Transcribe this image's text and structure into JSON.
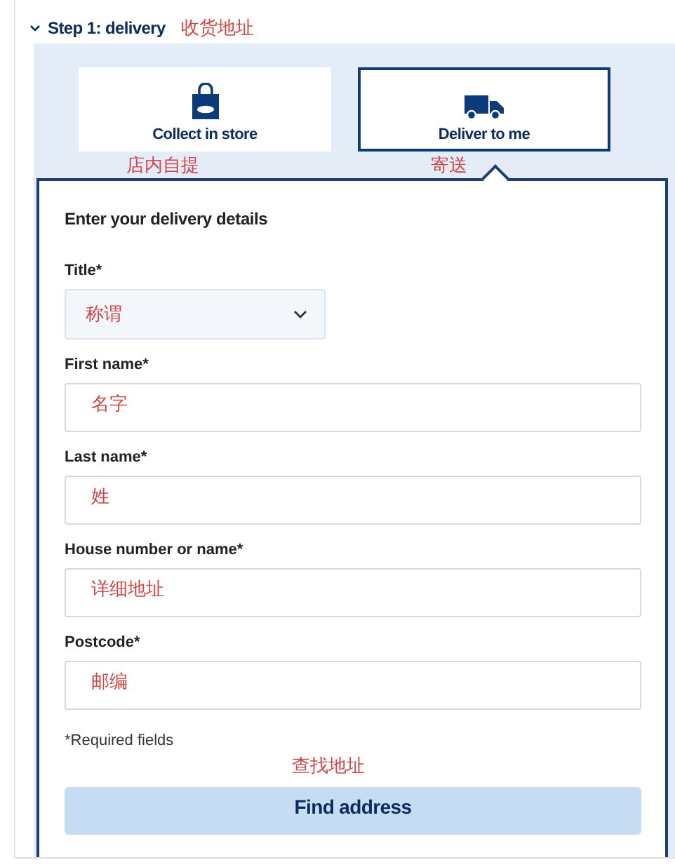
{
  "step": {
    "title": "Step 1: delivery",
    "expanded": true,
    "note": "收货地址"
  },
  "options": [
    {
      "kind": "store",
      "label": "Collect in store",
      "note": "店内自提",
      "selected": false
    },
    {
      "kind": "delivery",
      "label": "Deliver to me",
      "note": "寄送",
      "selected": true
    }
  ],
  "form": {
    "heading": "Enter your delivery details",
    "fields": [
      {
        "kind": "select",
        "label": "Title*",
        "note": "称谓"
      },
      {
        "kind": "text",
        "label": "First name*",
        "note": "名字"
      },
      {
        "kind": "text",
        "label": "Last name*",
        "note": "姓"
      },
      {
        "kind": "text",
        "label": "House number or name*",
        "note": "详细地址"
      },
      {
        "kind": "text",
        "label": "Postcode*",
        "note": "邮编"
      }
    ],
    "required_note": "*Required fields",
    "button_note": "查找地址",
    "button": "Find address"
  }
}
